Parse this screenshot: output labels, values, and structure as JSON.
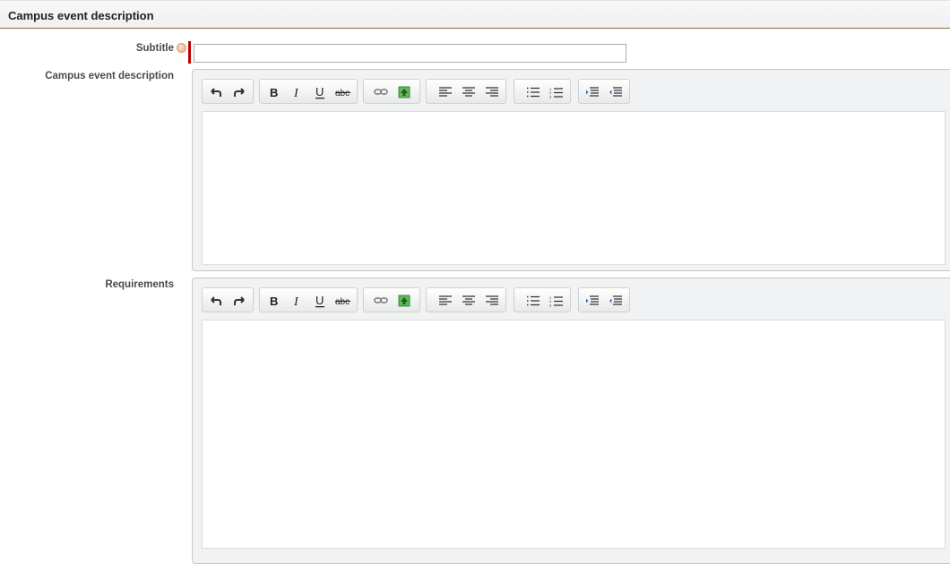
{
  "section": {
    "title": "Campus event description"
  },
  "fields": {
    "subtitle": {
      "label": "Subtitle",
      "value": "",
      "placeholder": ""
    },
    "description": {
      "label": "Campus event description"
    },
    "requirements": {
      "label": "Requirements"
    }
  },
  "toolbar": {
    "buttons": [
      "undo-icon",
      "redo-icon",
      "bold-icon",
      "italic-icon",
      "underline-icon",
      "strikethrough-icon",
      "link-icon",
      "insert-image-icon",
      "align-left-icon",
      "align-center-icon",
      "align-right-icon",
      "bulleted-list-icon",
      "numbered-list-icon",
      "indent-icon",
      "outdent-icon"
    ]
  },
  "colors": {
    "required": "#c00000",
    "header_rule": "#8a6a3a"
  }
}
